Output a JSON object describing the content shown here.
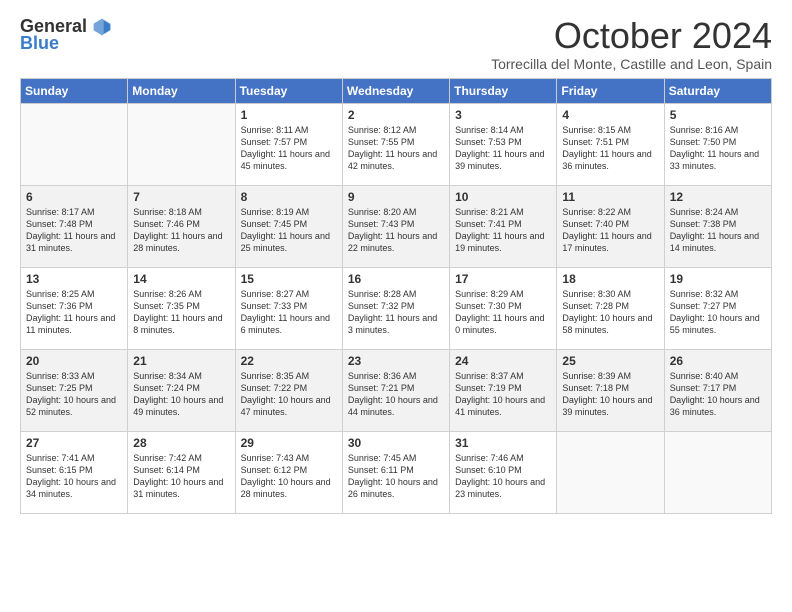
{
  "logo": {
    "general": "General",
    "blue": "Blue"
  },
  "header": {
    "month": "October 2024",
    "subtitle": "Torrecilla del Monte, Castille and Leon, Spain"
  },
  "days_of_week": [
    "Sunday",
    "Monday",
    "Tuesday",
    "Wednesday",
    "Thursday",
    "Friday",
    "Saturday"
  ],
  "weeks": [
    [
      {
        "day": "",
        "info": ""
      },
      {
        "day": "",
        "info": ""
      },
      {
        "day": "1",
        "info": "Sunrise: 8:11 AM\nSunset: 7:57 PM\nDaylight: 11 hours and 45 minutes."
      },
      {
        "day": "2",
        "info": "Sunrise: 8:12 AM\nSunset: 7:55 PM\nDaylight: 11 hours and 42 minutes."
      },
      {
        "day": "3",
        "info": "Sunrise: 8:14 AM\nSunset: 7:53 PM\nDaylight: 11 hours and 39 minutes."
      },
      {
        "day": "4",
        "info": "Sunrise: 8:15 AM\nSunset: 7:51 PM\nDaylight: 11 hours and 36 minutes."
      },
      {
        "day": "5",
        "info": "Sunrise: 8:16 AM\nSunset: 7:50 PM\nDaylight: 11 hours and 33 minutes."
      }
    ],
    [
      {
        "day": "6",
        "info": "Sunrise: 8:17 AM\nSunset: 7:48 PM\nDaylight: 11 hours and 31 minutes."
      },
      {
        "day": "7",
        "info": "Sunrise: 8:18 AM\nSunset: 7:46 PM\nDaylight: 11 hours and 28 minutes."
      },
      {
        "day": "8",
        "info": "Sunrise: 8:19 AM\nSunset: 7:45 PM\nDaylight: 11 hours and 25 minutes."
      },
      {
        "day": "9",
        "info": "Sunrise: 8:20 AM\nSunset: 7:43 PM\nDaylight: 11 hours and 22 minutes."
      },
      {
        "day": "10",
        "info": "Sunrise: 8:21 AM\nSunset: 7:41 PM\nDaylight: 11 hours and 19 minutes."
      },
      {
        "day": "11",
        "info": "Sunrise: 8:22 AM\nSunset: 7:40 PM\nDaylight: 11 hours and 17 minutes."
      },
      {
        "day": "12",
        "info": "Sunrise: 8:24 AM\nSunset: 7:38 PM\nDaylight: 11 hours and 14 minutes."
      }
    ],
    [
      {
        "day": "13",
        "info": "Sunrise: 8:25 AM\nSunset: 7:36 PM\nDaylight: 11 hours and 11 minutes."
      },
      {
        "day": "14",
        "info": "Sunrise: 8:26 AM\nSunset: 7:35 PM\nDaylight: 11 hours and 8 minutes."
      },
      {
        "day": "15",
        "info": "Sunrise: 8:27 AM\nSunset: 7:33 PM\nDaylight: 11 hours and 6 minutes."
      },
      {
        "day": "16",
        "info": "Sunrise: 8:28 AM\nSunset: 7:32 PM\nDaylight: 11 hours and 3 minutes."
      },
      {
        "day": "17",
        "info": "Sunrise: 8:29 AM\nSunset: 7:30 PM\nDaylight: 11 hours and 0 minutes."
      },
      {
        "day": "18",
        "info": "Sunrise: 8:30 AM\nSunset: 7:28 PM\nDaylight: 10 hours and 58 minutes."
      },
      {
        "day": "19",
        "info": "Sunrise: 8:32 AM\nSunset: 7:27 PM\nDaylight: 10 hours and 55 minutes."
      }
    ],
    [
      {
        "day": "20",
        "info": "Sunrise: 8:33 AM\nSunset: 7:25 PM\nDaylight: 10 hours and 52 minutes."
      },
      {
        "day": "21",
        "info": "Sunrise: 8:34 AM\nSunset: 7:24 PM\nDaylight: 10 hours and 49 minutes."
      },
      {
        "day": "22",
        "info": "Sunrise: 8:35 AM\nSunset: 7:22 PM\nDaylight: 10 hours and 47 minutes."
      },
      {
        "day": "23",
        "info": "Sunrise: 8:36 AM\nSunset: 7:21 PM\nDaylight: 10 hours and 44 minutes."
      },
      {
        "day": "24",
        "info": "Sunrise: 8:37 AM\nSunset: 7:19 PM\nDaylight: 10 hours and 41 minutes."
      },
      {
        "day": "25",
        "info": "Sunrise: 8:39 AM\nSunset: 7:18 PM\nDaylight: 10 hours and 39 minutes."
      },
      {
        "day": "26",
        "info": "Sunrise: 8:40 AM\nSunset: 7:17 PM\nDaylight: 10 hours and 36 minutes."
      }
    ],
    [
      {
        "day": "27",
        "info": "Sunrise: 7:41 AM\nSunset: 6:15 PM\nDaylight: 10 hours and 34 minutes."
      },
      {
        "day": "28",
        "info": "Sunrise: 7:42 AM\nSunset: 6:14 PM\nDaylight: 10 hours and 31 minutes."
      },
      {
        "day": "29",
        "info": "Sunrise: 7:43 AM\nSunset: 6:12 PM\nDaylight: 10 hours and 28 minutes."
      },
      {
        "day": "30",
        "info": "Sunrise: 7:45 AM\nSunset: 6:11 PM\nDaylight: 10 hours and 26 minutes."
      },
      {
        "day": "31",
        "info": "Sunrise: 7:46 AM\nSunset: 6:10 PM\nDaylight: 10 hours and 23 minutes."
      },
      {
        "day": "",
        "info": ""
      },
      {
        "day": "",
        "info": ""
      }
    ]
  ]
}
